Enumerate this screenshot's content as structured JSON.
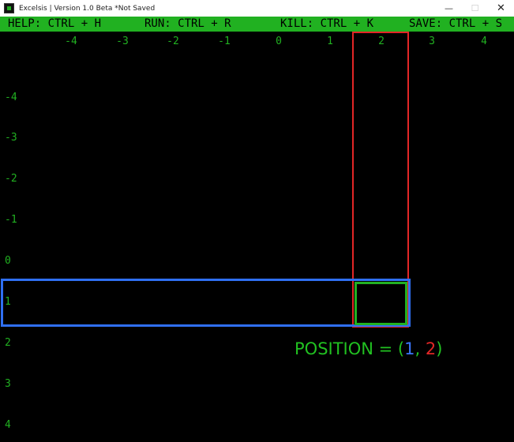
{
  "window": {
    "title": "Excelsis | Version 1.0 Beta  *Not Saved",
    "controls": {
      "minimize": "—",
      "maximize": "☐",
      "close": "✕"
    }
  },
  "shortcuts": {
    "help": "HELP: CTRL + H",
    "run": "RUN: CTRL + R",
    "kill": "KILL: CTRL + K",
    "save": "SAVE: CTRL + S"
  },
  "grid": {
    "column_labels": [
      "-4",
      "-3",
      "-2",
      "-1",
      "0",
      "1",
      "2",
      "3",
      "4"
    ],
    "row_labels": [
      "-4",
      "-3",
      "-2",
      "-1",
      "0",
      "1",
      "2",
      "3",
      "4"
    ],
    "selected_column": "2",
    "selected_row": "1"
  },
  "position": {
    "prefix": "POSITION = (",
    "row": "1",
    "separator": ", ",
    "col": "2",
    "suffix": ")"
  },
  "colors": {
    "background": "#000000",
    "accent_green": "#21b121",
    "row_highlight": "#2f6ff2",
    "column_highlight": "#e32626",
    "cell_highlight": "#22b022"
  }
}
